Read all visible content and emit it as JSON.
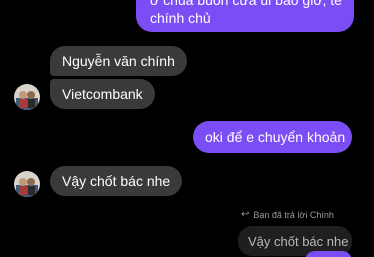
{
  "messages": [
    {
      "id": "m1",
      "from": "me",
      "lines": [
        "ở chùa buồn cửa ủi bảo giờ, tê",
        "chính chủ"
      ]
    },
    {
      "id": "m2",
      "from": "other",
      "text": "Nguyễn văn chính"
    },
    {
      "id": "m3",
      "from": "other",
      "text": "Vietcombank"
    },
    {
      "id": "m4",
      "from": "me",
      "text": "oki để e chuyển khoản"
    },
    {
      "id": "m5",
      "from": "other",
      "text": "Vậy chốt bác nhe"
    }
  ],
  "reply": {
    "note": "Bạn đã trả lời Chính",
    "quoted_text": "Vậy chốt bác nhe"
  },
  "colors": {
    "sent_bubble": "#7B4DF5",
    "received_bubble": "#3A3A3C",
    "background": "#000000"
  }
}
